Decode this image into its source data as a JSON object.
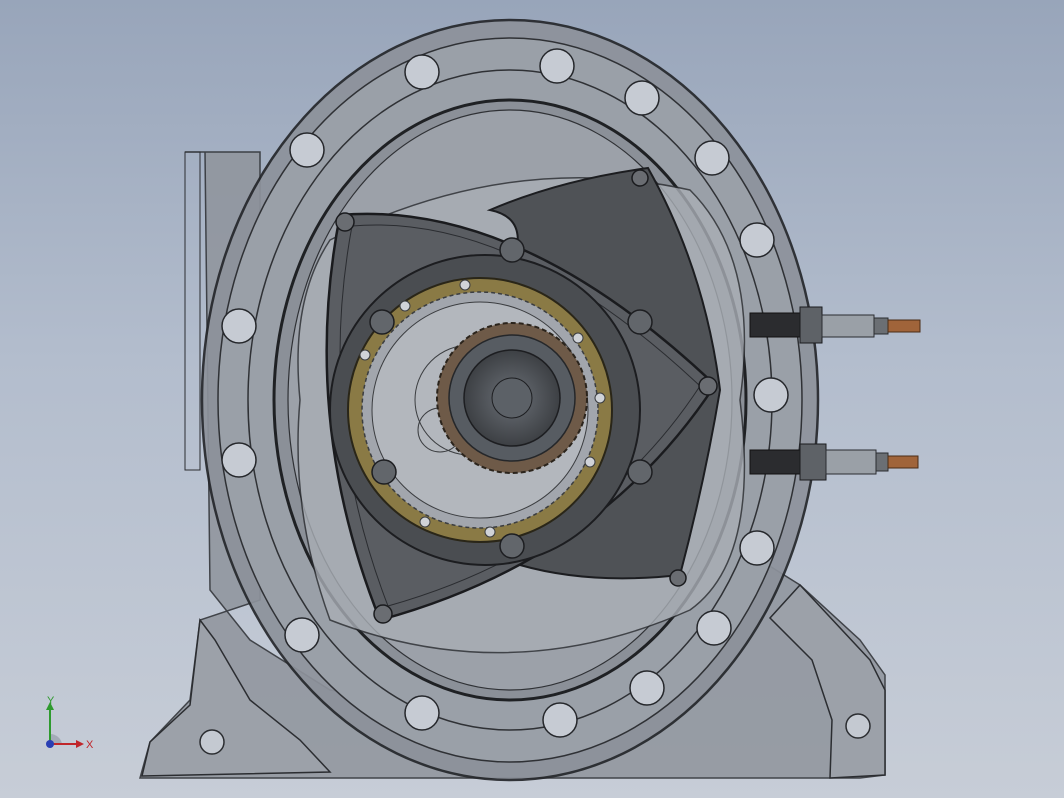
{
  "viewport": {
    "background_top": "#98a5ba",
    "background_bottom": "#c7cdd7"
  },
  "model": {
    "housing_color": "#8d929b",
    "rotor_color": "#55575b",
    "ring_gear_color": "#8a7a45",
    "pinion_color": "#6e5a48",
    "spark_plug_tip_color": "#a0643a"
  },
  "triad": {
    "x_label": "X",
    "y_label": "Y",
    "x_color": "#c0262b",
    "y_color": "#2e9a2e",
    "z_color": "#2a3fb4"
  }
}
